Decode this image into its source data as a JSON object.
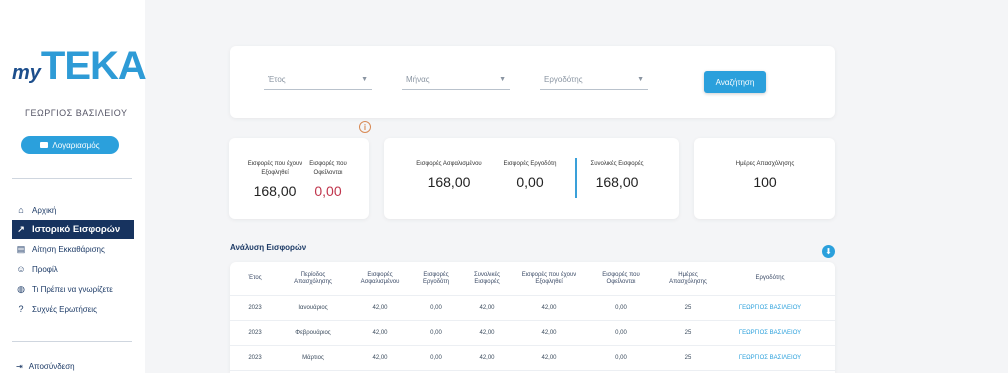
{
  "sidebar": {
    "logo_my": "my",
    "logo_teka": "TEKA",
    "user_name": "ΓΕΩΡΓΙΟΣ ΒΑΣΙΛΕΙΟΥ",
    "profile_button": "Λογαριασμός",
    "items": [
      {
        "label": "Αρχική",
        "icon": "home-icon",
        "glyph": "⌂"
      },
      {
        "label": "Ιστορικό Εισφορών",
        "icon": "trend-icon",
        "glyph": "↗",
        "active": true
      },
      {
        "label": "Αίτηση Εκκαθάρισης",
        "icon": "card-icon",
        "glyph": "▤"
      },
      {
        "label": "Προφίλ",
        "icon": "user-icon",
        "glyph": "☺"
      },
      {
        "label": "Τι Πρέπει να γνωρίζετε",
        "icon": "globe-icon",
        "glyph": "◍"
      },
      {
        "label": "Συχνές Ερωτήσεις",
        "icon": "question-icon",
        "glyph": "?"
      }
    ],
    "bottom_label": "Αποσύνδεση",
    "bottom_icon": "logout-icon"
  },
  "filters": {
    "selects": [
      {
        "label": "Έτος"
      },
      {
        "label": "Μήνας"
      },
      {
        "label": "Εργοδότης"
      }
    ],
    "search_button": "Αναζήτηση"
  },
  "summary": {
    "card1": [
      {
        "label": "Εισφορές που έχουν Εξοφληθεί",
        "value": "168,00"
      },
      {
        "label": "Εισφορές που Οφείλονται",
        "value": "0,00"
      }
    ],
    "card2": [
      {
        "label": "Εισφορές Ασφαλισμένου",
        "value": "168,00"
      },
      {
        "label": "Εισφορές Εργοδότη",
        "value": "0,00"
      },
      {
        "label": "Συνολικές Εισφορές",
        "value": "168,00"
      }
    ],
    "card3": {
      "label": "Ημέρες Απασχόλησης",
      "value": "100"
    }
  },
  "table": {
    "title": "Ανάλυση Εισφορών",
    "headers": [
      "Έτος",
      "Περίοδος Απασχόλησης",
      "Εισφορές Ασφαλισμένου",
      "Εισφορές Εργοδότη",
      "Συνολικές Εισφορές",
      "Εισφορές που έχουν Εξοφληθεί",
      "Εισφορές που Οφείλονται",
      "Ημέρες Απασχόλησης",
      "Εργοδότης"
    ],
    "rows": [
      [
        "2023",
        "Ιανουάριος",
        "42,00",
        "0,00",
        "42,00",
        "42,00",
        "0,00",
        "25",
        "ΓΕΩΡΓΙΟΣ ΒΑΣΙΛΕΙΟΥ"
      ],
      [
        "2023",
        "Φεβρουάριος",
        "42,00",
        "0,00",
        "42,00",
        "42,00",
        "0,00",
        "25",
        "ΓΕΩΡΓΙΟΣ ΒΑΣΙΛΕΙΟΥ"
      ],
      [
        "2023",
        "Μάρτιος",
        "42,00",
        "0,00",
        "42,00",
        "42,00",
        "0,00",
        "25",
        "ΓΕΩΡΓΙΟΣ ΒΑΣΙΛΕΙΟΥ"
      ]
    ]
  },
  "colors": {
    "accent": "#2ba0dc",
    "nav_active": "#17335f",
    "due_red": "#c0354c"
  }
}
